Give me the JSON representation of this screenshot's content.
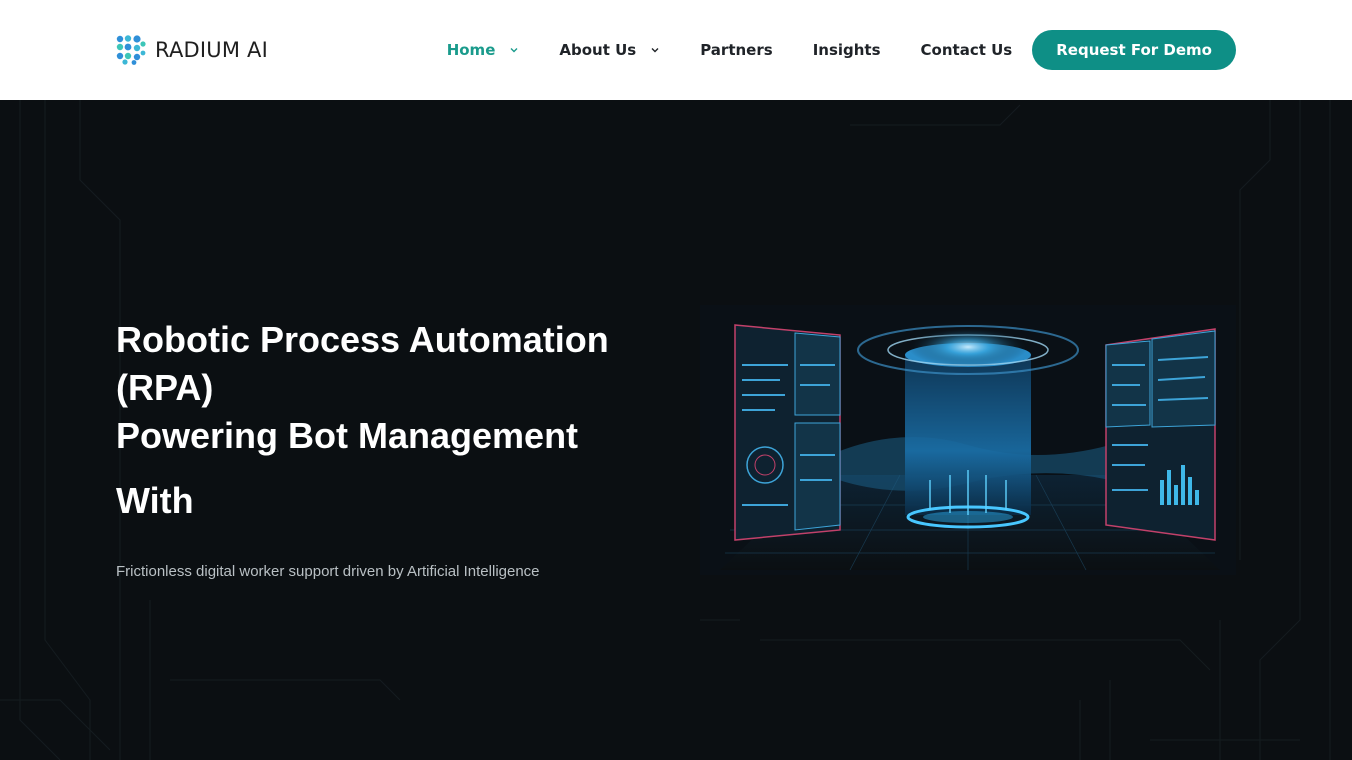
{
  "header": {
    "brand": "RADIUM AI",
    "nav": [
      {
        "label": "Home",
        "active": true,
        "has_dropdown": true
      },
      {
        "label": "About Us",
        "active": false,
        "has_dropdown": true
      },
      {
        "label": "Partners",
        "active": false,
        "has_dropdown": false
      },
      {
        "label": "Insights",
        "active": false,
        "has_dropdown": false
      },
      {
        "label": "Contact Us",
        "active": false,
        "has_dropdown": false
      }
    ],
    "cta_label": "Request For Demo"
  },
  "hero": {
    "title_line1": "Robotic Process Automation",
    "title_line2": "(RPA)",
    "title_line3": "Powering Bot Management",
    "title_with": "With",
    "subtitle": "Frictionless digital worker support driven by Artificial Intelligence"
  },
  "colors": {
    "accent": "#0e8f86",
    "active_nav": "#1a9b8c",
    "hero_bg": "#0b0f12",
    "logo_blue": "#2f8fd8",
    "logo_teal": "#3cc6b8"
  },
  "icons": {
    "logo": "radium-dot-grid-icon",
    "dropdown": "chevron-down-icon"
  }
}
